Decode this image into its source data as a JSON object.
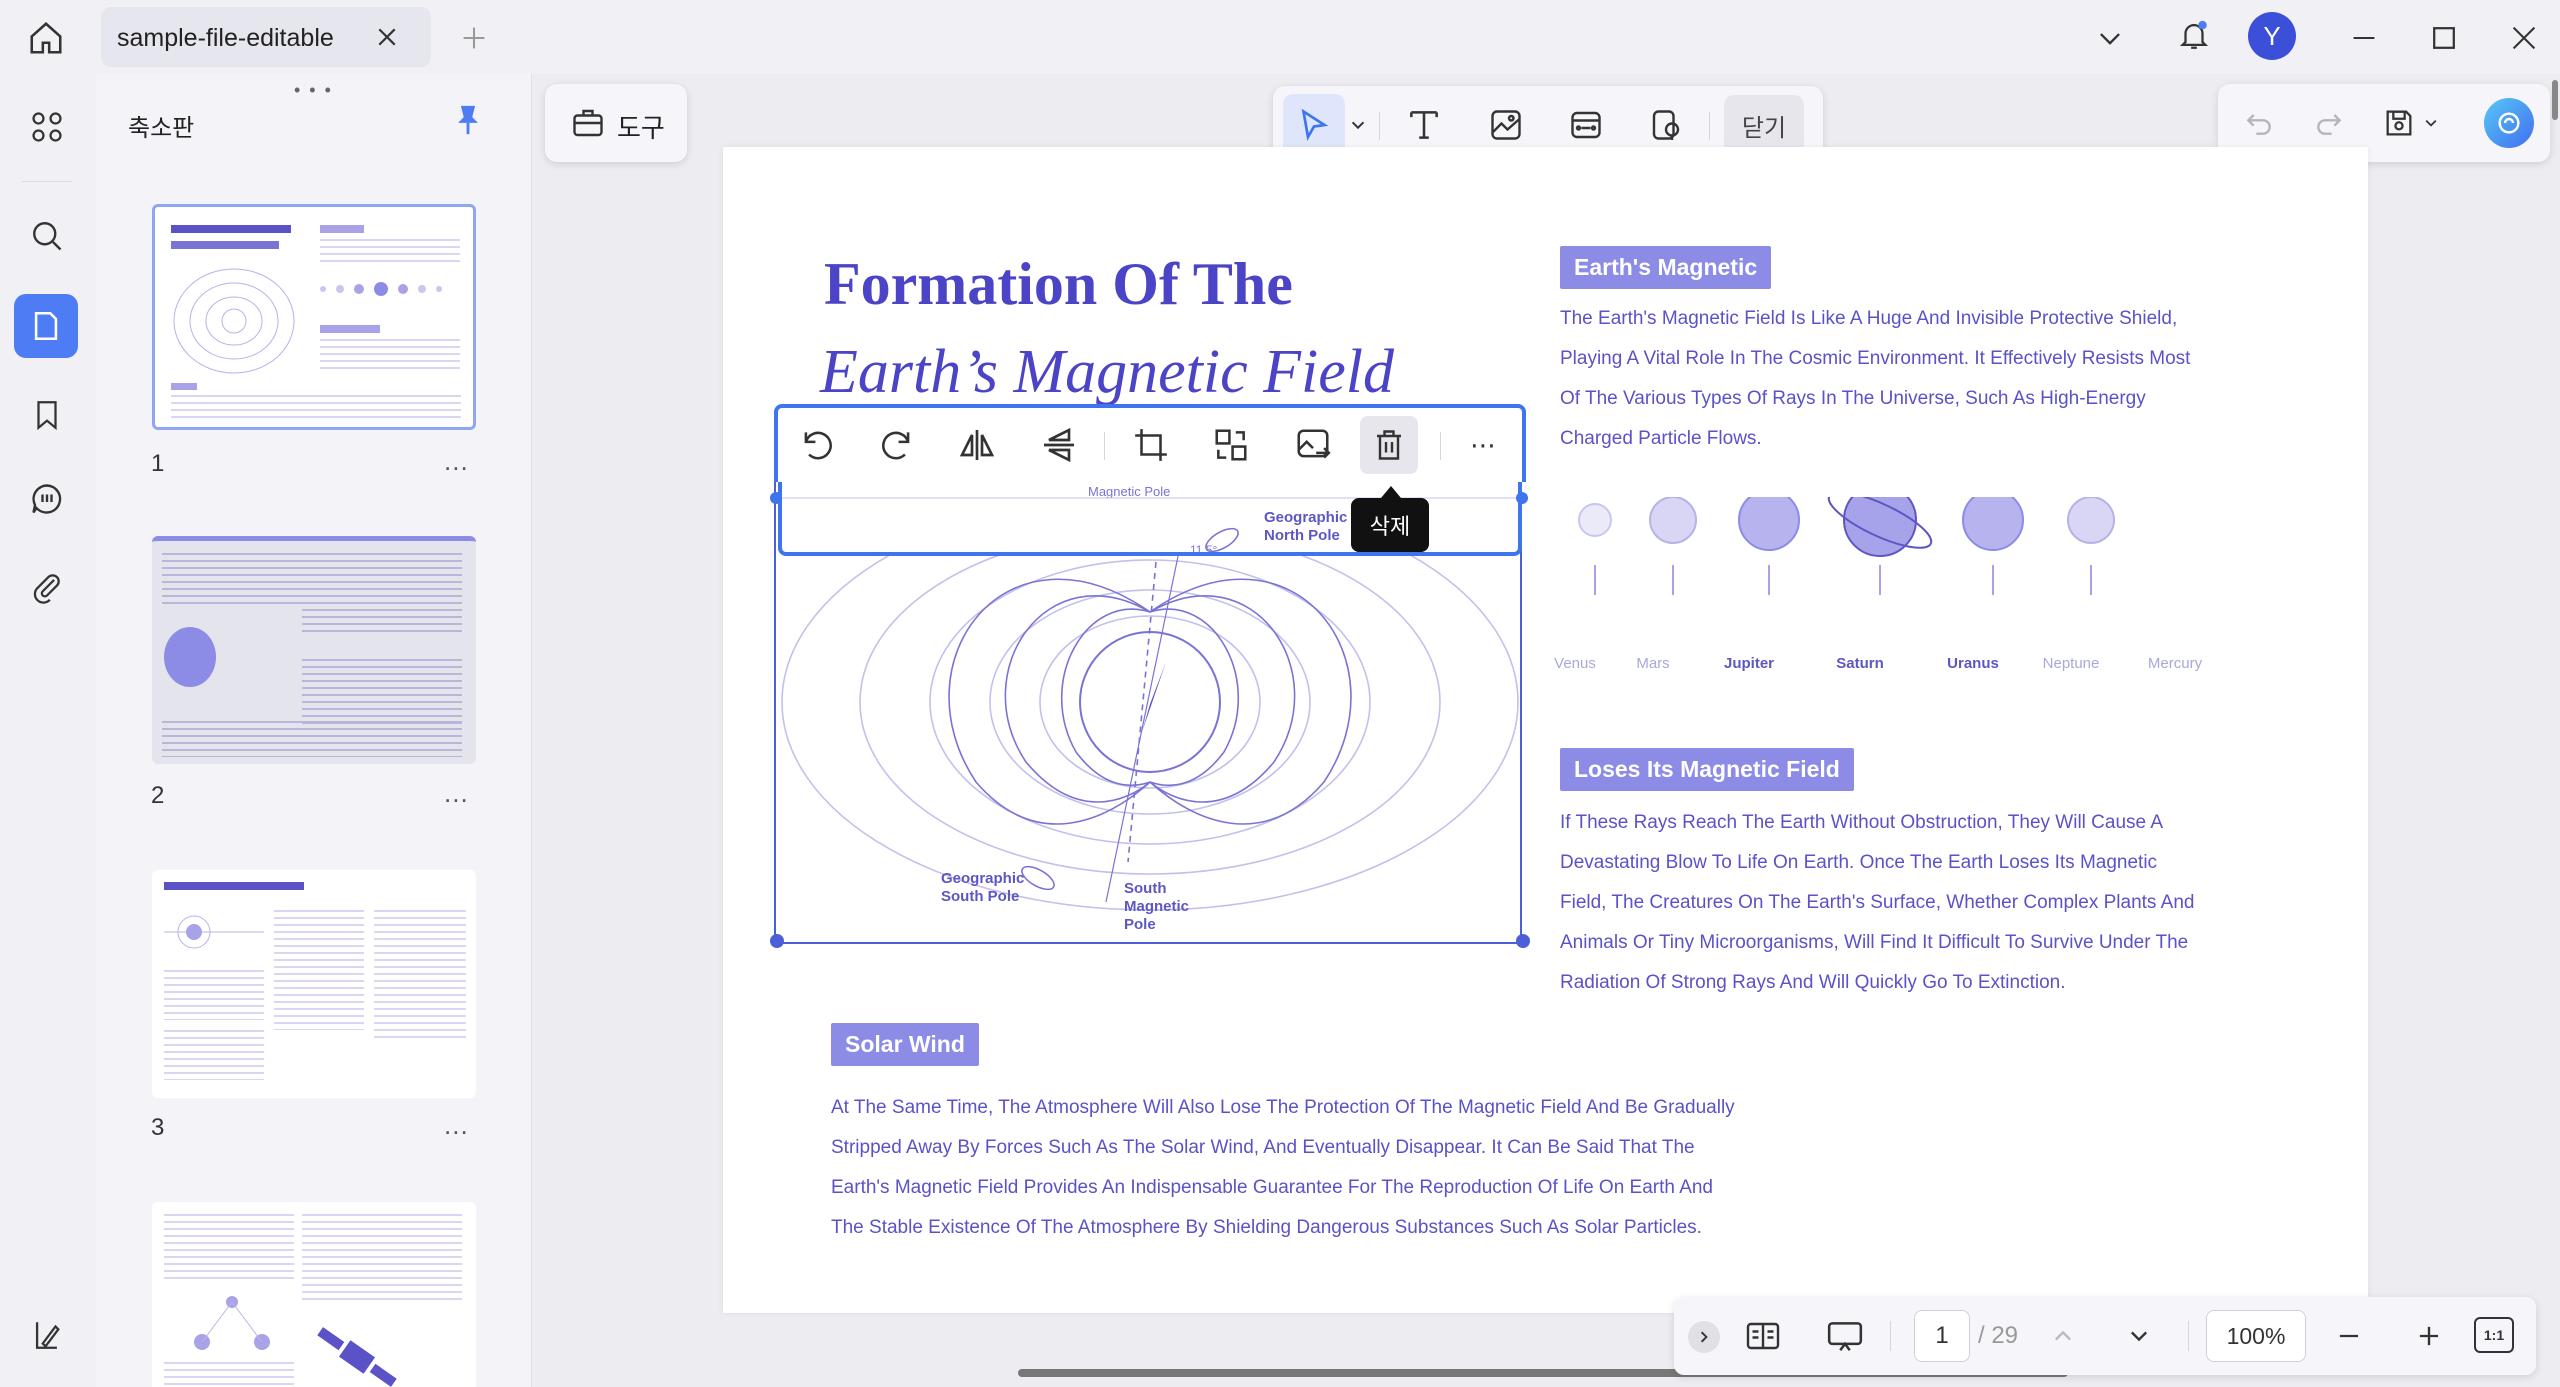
{
  "tab": {
    "title": "sample-file-editable"
  },
  "avatar": {
    "letter": "Y"
  },
  "thumbnails": {
    "title": "축소판",
    "pages": [
      {
        "num": "1"
      },
      {
        "num": "2"
      },
      {
        "num": "3"
      }
    ],
    "more": "..."
  },
  "toolbar": {
    "tools_label": "도구",
    "close_label": "닫기"
  },
  "image_tooltip": "삭제",
  "doc": {
    "title_line1": "Formation Of The",
    "title_line2": "Earth’s Magnetic Field",
    "diagram": {
      "magnetic_pole": "Magnetic Pole",
      "geo_north": [
        "Geographic",
        "North Pole"
      ],
      "geo_south": [
        "Geographic",
        "South Pole"
      ],
      "south_magnetic": [
        "South",
        "Magnetic",
        "Pole"
      ],
      "angle": "11.5°"
    },
    "section1": {
      "heading": "Earth's Magnetic",
      "lines": [
        "The Earth's Magnetic Field Is Like A Huge And Invisible Protective Shield,",
        "Playing A Vital Role In The Cosmic Environment. It Effectively Resists Most",
        "Of The Various Types Of Rays In The Universe, Such As High-Energy",
        "Charged Particle Flows."
      ]
    },
    "planets": [
      "Venus",
      "Mars",
      "Jupiter",
      "Saturn",
      "Uranus",
      "Neptune",
      "Mercury"
    ],
    "section2": {
      "heading": "Loses Its Magnetic Field",
      "lines": [
        "If These Rays Reach The Earth Without Obstruction, They Will Cause A",
        "Devastating Blow To Life On Earth. Once The Earth Loses Its Magnetic",
        "Field, The Creatures On The Earth's Surface, Whether Complex Plants And",
        "Animals Or Tiny Microorganisms, Will Find It Difficult To Survive Under The",
        "Radiation Of Strong Rays And Will Quickly Go To Extinction."
      ]
    },
    "section3": {
      "heading": "Solar Wind",
      "lines": [
        "At The Same Time, The Atmosphere Will Also Lose The Protection Of The Magnetic Field And Be Gradually",
        "Stripped Away By Forces Such As The Solar Wind, And Eventually Disappear. It Can Be Said That The",
        "Earth's Magnetic Field Provides An Indispensable Guarantee For The Reproduction Of Life On Earth And",
        "The Stable Existence Of The Atmosphere By Shielding Dangerous Substances Such As Solar Particles."
      ]
    }
  },
  "pager": {
    "current": "1",
    "total": "/ 29",
    "zoom": "100%",
    "fit": "1:1"
  },
  "colors": {
    "accent": "#4d7cf5",
    "title": "#4b44c6",
    "pill": "#8c8ce6",
    "text": "#5b52c8"
  }
}
